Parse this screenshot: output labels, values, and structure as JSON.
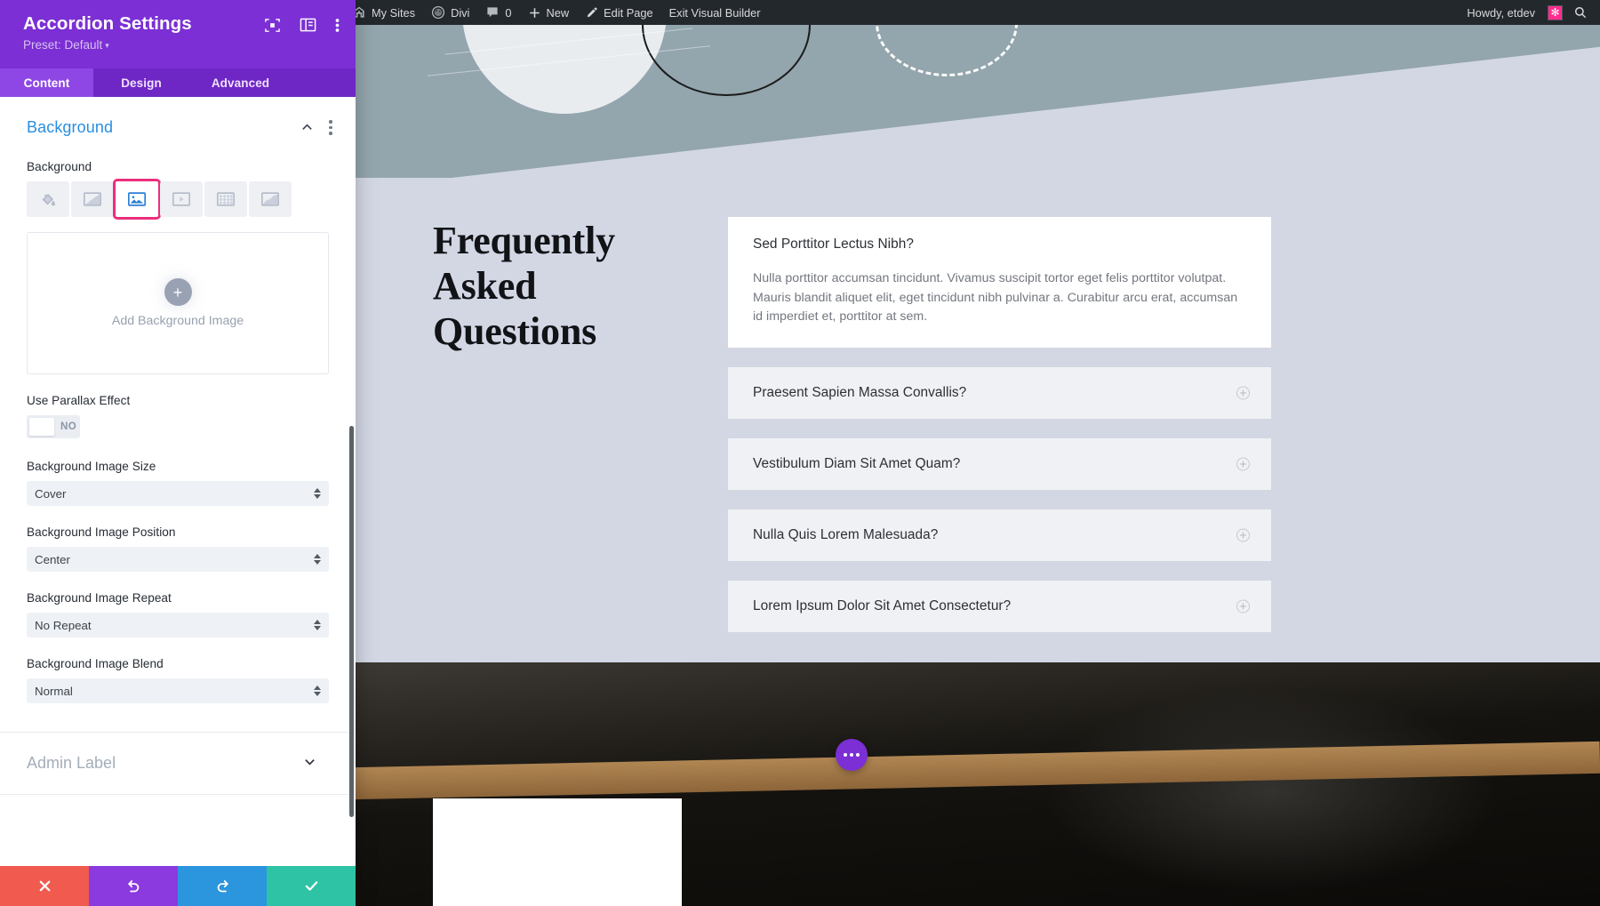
{
  "panel": {
    "title": "Accordion Settings",
    "preset": "Preset: Default",
    "preset_caret": "▾",
    "header_icons": [
      {
        "name": "focus-icon"
      },
      {
        "name": "panel-layout-icon"
      },
      {
        "name": "kebab-menu-icon"
      }
    ],
    "tabs": [
      {
        "id": "content",
        "label": "Content",
        "active": true
      },
      {
        "id": "design",
        "label": "Design",
        "active": false
      },
      {
        "id": "advanced",
        "label": "Advanced",
        "active": false
      }
    ],
    "section": {
      "title": "Background",
      "field_label": "Background",
      "background_types": [
        {
          "name": "background-color-icon",
          "label": "Color",
          "selected": false
        },
        {
          "name": "background-gradient-icon",
          "label": "Gradient",
          "selected": false
        },
        {
          "name": "background-image-icon",
          "label": "Image",
          "selected": true
        },
        {
          "name": "background-video-icon",
          "label": "Video",
          "selected": false
        },
        {
          "name": "background-pattern-icon",
          "label": "Pattern",
          "selected": false
        },
        {
          "name": "background-mask-icon",
          "label": "Mask",
          "selected": false
        }
      ],
      "dropzone": {
        "plus": "+",
        "text": "Add Background Image"
      },
      "parallax": {
        "label": "Use Parallax Effect",
        "value": "NO"
      },
      "selects": [
        {
          "label": "Background Image Size",
          "value": "Cover"
        },
        {
          "label": "Background Image Position",
          "value": "Center"
        },
        {
          "label": "Background Image Repeat",
          "value": "No Repeat"
        },
        {
          "label": "Background Image Blend",
          "value": "Normal"
        }
      ],
      "admin_label": "Admin Label"
    },
    "footer": [
      {
        "name": "cancel-button",
        "glyph": "✕"
      },
      {
        "name": "undo-button",
        "glyph": "↺"
      },
      {
        "name": "redo-button",
        "glyph": "↻"
      },
      {
        "name": "save-button",
        "glyph": "✓"
      }
    ]
  },
  "adminbar": {
    "left_items": [
      {
        "name": "wordpress-logo-icon",
        "label": ""
      },
      {
        "name": "my-sites-menu",
        "label": "My Sites"
      },
      {
        "name": "divi-menu",
        "label": "Divi"
      },
      {
        "name": "comments-menu",
        "label": "0"
      },
      {
        "name": "new-menu",
        "label": "New"
      },
      {
        "name": "edit-page-menu",
        "label": "Edit Page"
      },
      {
        "name": "exit-visual-builder",
        "label": "Exit Visual Builder"
      }
    ],
    "howdy": "Howdy, etdev",
    "avatar_glyph": "✻",
    "search": "search-icon"
  },
  "preview": {
    "faq_heading": "Frequently Asked Questions",
    "accordion": [
      {
        "question": "Sed Porttitor Lectus Nibh?",
        "answer": "Nulla porttitor accumsan tincidunt. Vivamus suscipit tortor eget felis porttitor volutpat. Mauris blandit aliquet elit, eget tincidunt nibh pulvinar a. Curabitur arcu erat, accumsan id imperdiet et, porttitor at sem.",
        "open": true
      },
      {
        "question": "Praesent Sapien Massa Convallis?",
        "answer": "",
        "open": false
      },
      {
        "question": "Vestibulum Diam Sit Amet Quam?",
        "answer": "",
        "open": false
      },
      {
        "question": "Nulla Quis Lorem Malesuada?",
        "answer": "",
        "open": false
      },
      {
        "question": "Lorem Ipsum Dolor Sit Amet Consectetur?",
        "answer": "",
        "open": false
      }
    ],
    "fab": "page-settings-fab"
  },
  "colors": {
    "panel_header": "#7b2fd4",
    "tab_active": "#8e47e4",
    "section_title": "#2a8ede",
    "selection_outline": "#ec2f7b",
    "adminbar_bg": "#23282d",
    "avatar_pink": "#ff2d8e",
    "page_bg": "#d3d7e4",
    "cancel": "#f05a4f",
    "undo": "#8b3ae0",
    "redo": "#2b95dd",
    "save": "#2ec3a5"
  }
}
